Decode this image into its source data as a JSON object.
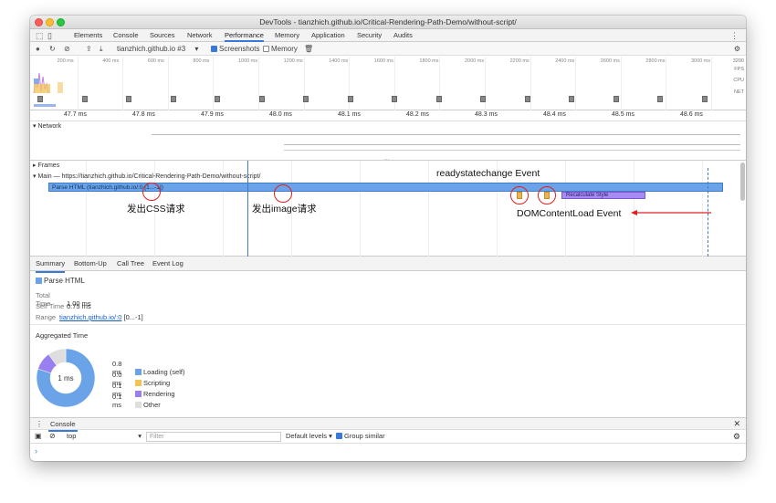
{
  "window": {
    "title": "DevTools - tianzhich.github.io/Critical-Rendering-Path-Demo/without-script/"
  },
  "tabs": [
    {
      "label": "Elements"
    },
    {
      "label": "Console"
    },
    {
      "label": "Sources"
    },
    {
      "label": "Network"
    },
    {
      "label": "Performance",
      "active": true
    },
    {
      "label": "Memory"
    },
    {
      "label": "Application"
    },
    {
      "label": "Security"
    },
    {
      "label": "Audits"
    }
  ],
  "toolbar": {
    "profile_select": "tianzhich.github.io #3",
    "screenshots_label": "Screenshots",
    "screenshots_checked": true,
    "memory_label": "Memory",
    "memory_checked": false
  },
  "overview": {
    "ticks": [
      "200 ms",
      "400 ms",
      "600 ms",
      "800 ms",
      "1000 ms",
      "1200 ms",
      "1400 ms",
      "1600 ms",
      "1800 ms",
      "2000 ms",
      "2200 ms",
      "2400 ms",
      "2600 ms",
      "2800 ms",
      "3000 ms",
      "3200"
    ],
    "side_labels": {
      "fps": "FPS",
      "cpu": "CPU",
      "net": "NET"
    }
  },
  "ruler": {
    "ticks": [
      "47.7 ms",
      "47.8 ms",
      "47.9 ms",
      "48.0 ms",
      "48.1 ms",
      "48.2 ms",
      "48.3 ms",
      "48.4 ms",
      "48.5 ms",
      "48.6 ms"
    ]
  },
  "tracks": {
    "network_label": "Network",
    "frames_label": "Frames",
    "main_label": "Main — https://tianzhich.github.io/Critical-Rendering-Path-Demo/without-script/",
    "parse_html_bar": "Parse HTML (tianzhich.github.io/:0 [1...-1])",
    "recalc_bar": "Recalculate Style"
  },
  "annotations": {
    "css_request": "发出CSS请求",
    "image_request": "发出image请求",
    "readystatechange": "readystatechange Event",
    "domcontentload": "DOMContentLoad Event"
  },
  "detail_tabs": [
    {
      "label": "Summary",
      "active": true
    },
    {
      "label": "Bottom-Up"
    },
    {
      "label": "Call Tree"
    },
    {
      "label": "Event Log"
    }
  ],
  "summary": {
    "title": "Parse HTML",
    "title_color": "#6aa3e8",
    "total_time_label": "Total Time",
    "total_time": "1.00 ms",
    "self_time_label": "Self Time",
    "self_time": "0.75 ms",
    "range_label": "Range",
    "range_link": "tianzhich.github.io/:0",
    "range_suffix": "[0...-1]",
    "aggregated_title": "Aggregated Time",
    "donut_center": "1 ms",
    "legend": [
      {
        "value": "0.8 ms",
        "label": "Loading (self)",
        "color": "#6aa3e8"
      },
      {
        "value": "0.0 ms",
        "label": "Scripting",
        "color": "#f1c453"
      },
      {
        "value": "0.1 ms",
        "label": "Rendering",
        "color": "#9a7ff0"
      },
      {
        "value": "0.1 ms",
        "label": "Other",
        "color": "#dedede"
      }
    ]
  },
  "console": {
    "tab_label": "Console",
    "context": "top",
    "filter_placeholder": "Filter",
    "levels": "Default levels ▾",
    "group_similar_label": "Group similar",
    "group_similar_checked": true,
    "prompt": "›"
  }
}
